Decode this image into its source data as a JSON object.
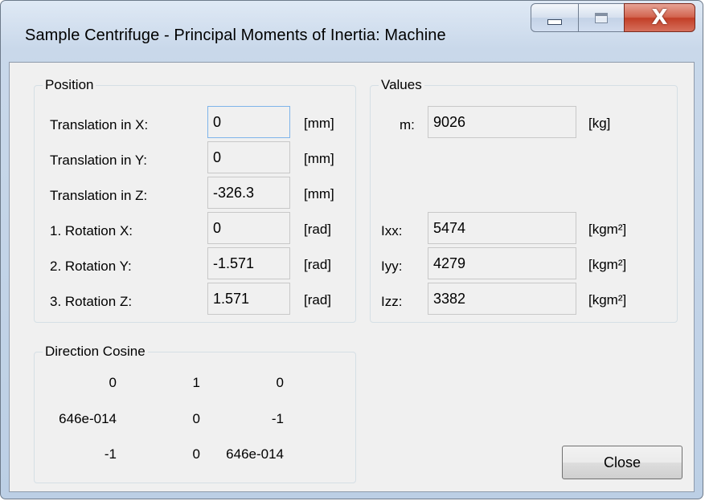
{
  "window": {
    "title": "Sample Centrifuge - Principal Moments of Inertia: Machine",
    "close_glyph": "X"
  },
  "position": {
    "group_label": "Position",
    "rows": [
      {
        "label": "Translation in X:",
        "value": "0",
        "unit": "[mm]"
      },
      {
        "label": "Translation in Y:",
        "value": "0",
        "unit": "[mm]"
      },
      {
        "label": "Translation in Z:",
        "value": "-326.3",
        "unit": "[mm]"
      },
      {
        "label": "1. Rotation  X:",
        "value": "0",
        "unit": "[rad]"
      },
      {
        "label": "2. Rotation  Y:",
        "value": "-1.571",
        "unit": "[rad]"
      },
      {
        "label": "3. Rotation  Z:",
        "value": "1.571",
        "unit": "[rad]"
      }
    ]
  },
  "values": {
    "group_label": "Values",
    "mass": {
      "label": "m:",
      "value": "9026",
      "unit": "[kg]"
    },
    "inertia": [
      {
        "label": "Ixx:",
        "value": "5474",
        "unit": "[kgm²]"
      },
      {
        "label": "Iyy:",
        "value": "4279",
        "unit": "[kgm²]"
      },
      {
        "label": "Izz:",
        "value": "3382",
        "unit": "[kgm²]"
      }
    ]
  },
  "direction_cosine": {
    "group_label": "Direction Cosine",
    "matrix": [
      [
        "0",
        "1",
        "0"
      ],
      [
        "646e-014",
        "0",
        "-1"
      ],
      [
        "-1",
        "0",
        "646e-014"
      ]
    ]
  },
  "buttons": {
    "close_label": "Close"
  }
}
